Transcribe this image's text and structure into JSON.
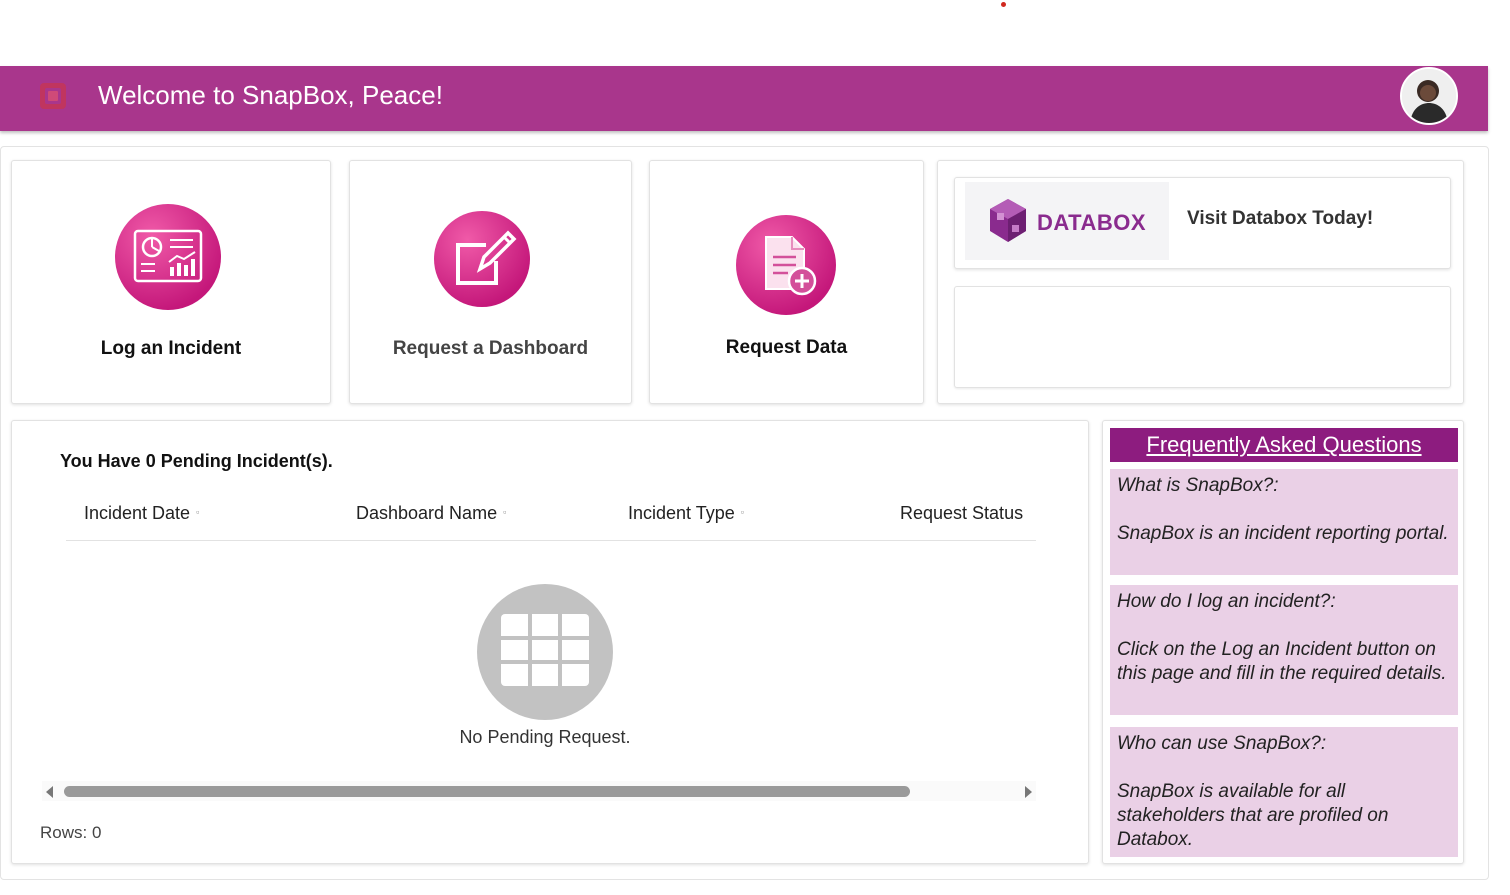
{
  "header": {
    "title": "Welcome to SnapBox, Peace!",
    "brand_color": "#a9368c"
  },
  "tiles": [
    {
      "label": "Log an Incident",
      "icon": "dashboard-report-icon"
    },
    {
      "label": "Request a Dashboard",
      "icon": "edit-note-icon"
    },
    {
      "label": "Request Data",
      "icon": "add-document-icon"
    }
  ],
  "databox": {
    "brand": "DATABOX",
    "link_text": "Visit Databox Today!"
  },
  "incidents": {
    "title": "You Have 0 Pending Incident(s).",
    "columns": [
      "Incident Date",
      "Dashboard Name",
      "Incident Type",
      "Request Status"
    ],
    "empty_text": "No Pending Request.",
    "rows_label": "Rows: 0"
  },
  "faq": {
    "title": "Frequently Asked Questions",
    "header_color": "#8d1c7f",
    "items": [
      {
        "q": "What is SnapBox?:",
        "a": "SnapBox is an incident reporting portal."
      },
      {
        "q": "How do I log an incident?:",
        "a": "Click on the Log an Incident button on this page and fill in the required details."
      },
      {
        "q": "Who can use SnapBox?:",
        "a": "SnapBox is available for all stakeholders that are profiled on Databox."
      }
    ]
  }
}
